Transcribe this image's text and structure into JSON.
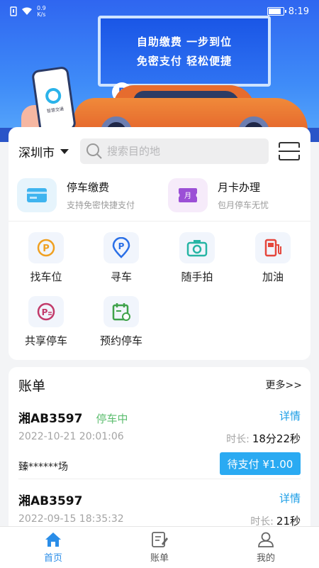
{
  "status_bar": {
    "network_speed": "0.9",
    "network_unit": "K/s",
    "time": "8:19",
    "battery_level": 0.85
  },
  "banner": {
    "line1": "自助缴费  一步到位",
    "line2": "免密支付  轻松便捷",
    "phone_text": "智慧交通",
    "pin_label": "P"
  },
  "search": {
    "city": "深圳市",
    "placeholder": "搜索目的地"
  },
  "features": [
    {
      "title": "停车缴费",
      "subtitle": "支持免密快捷支付",
      "icon": "card-icon",
      "color": "#e6f4fc"
    },
    {
      "title": "月卡办理",
      "subtitle": "包月停车无忧",
      "icon": "month-card-icon",
      "color": "#f6ebfa"
    }
  ],
  "grid": [
    {
      "label": "找车位",
      "icon": "parking-search-icon"
    },
    {
      "label": "寻车",
      "icon": "parking-pin-icon"
    },
    {
      "label": "随手拍",
      "icon": "camera-icon"
    },
    {
      "label": "加油",
      "icon": "fuel-icon"
    },
    {
      "label": "共享停车",
      "icon": "shared-parking-icon"
    },
    {
      "label": "预约停车",
      "icon": "reserve-calendar-icon"
    }
  ],
  "bills": {
    "title": "账单",
    "more": "更多>>",
    "items": [
      {
        "plate": "湘AB3597",
        "status": "停车中",
        "detail": "详情",
        "time": "2022-10-21 20:01:06",
        "duration_label": "时长:",
        "duration": "18分22秒",
        "pay_label": "待支付 ¥1.00",
        "lot": "臻******场"
      },
      {
        "plate": "湘AB3597",
        "status": "",
        "detail": "详情",
        "time": "2022-09-15 18:35:32",
        "duration_label": "时长:",
        "duration": "21秒"
      }
    ]
  },
  "tabs": [
    {
      "label": "首页",
      "icon": "home-icon",
      "active": true
    },
    {
      "label": "账单",
      "icon": "bill-icon",
      "active": false
    },
    {
      "label": "我的",
      "icon": "profile-icon",
      "active": false
    }
  ],
  "colors": {
    "accent": "#2a8de8",
    "pay_button": "#2aaaf2",
    "status_green": "#5bbd6e",
    "link": "#1c9ee6"
  }
}
